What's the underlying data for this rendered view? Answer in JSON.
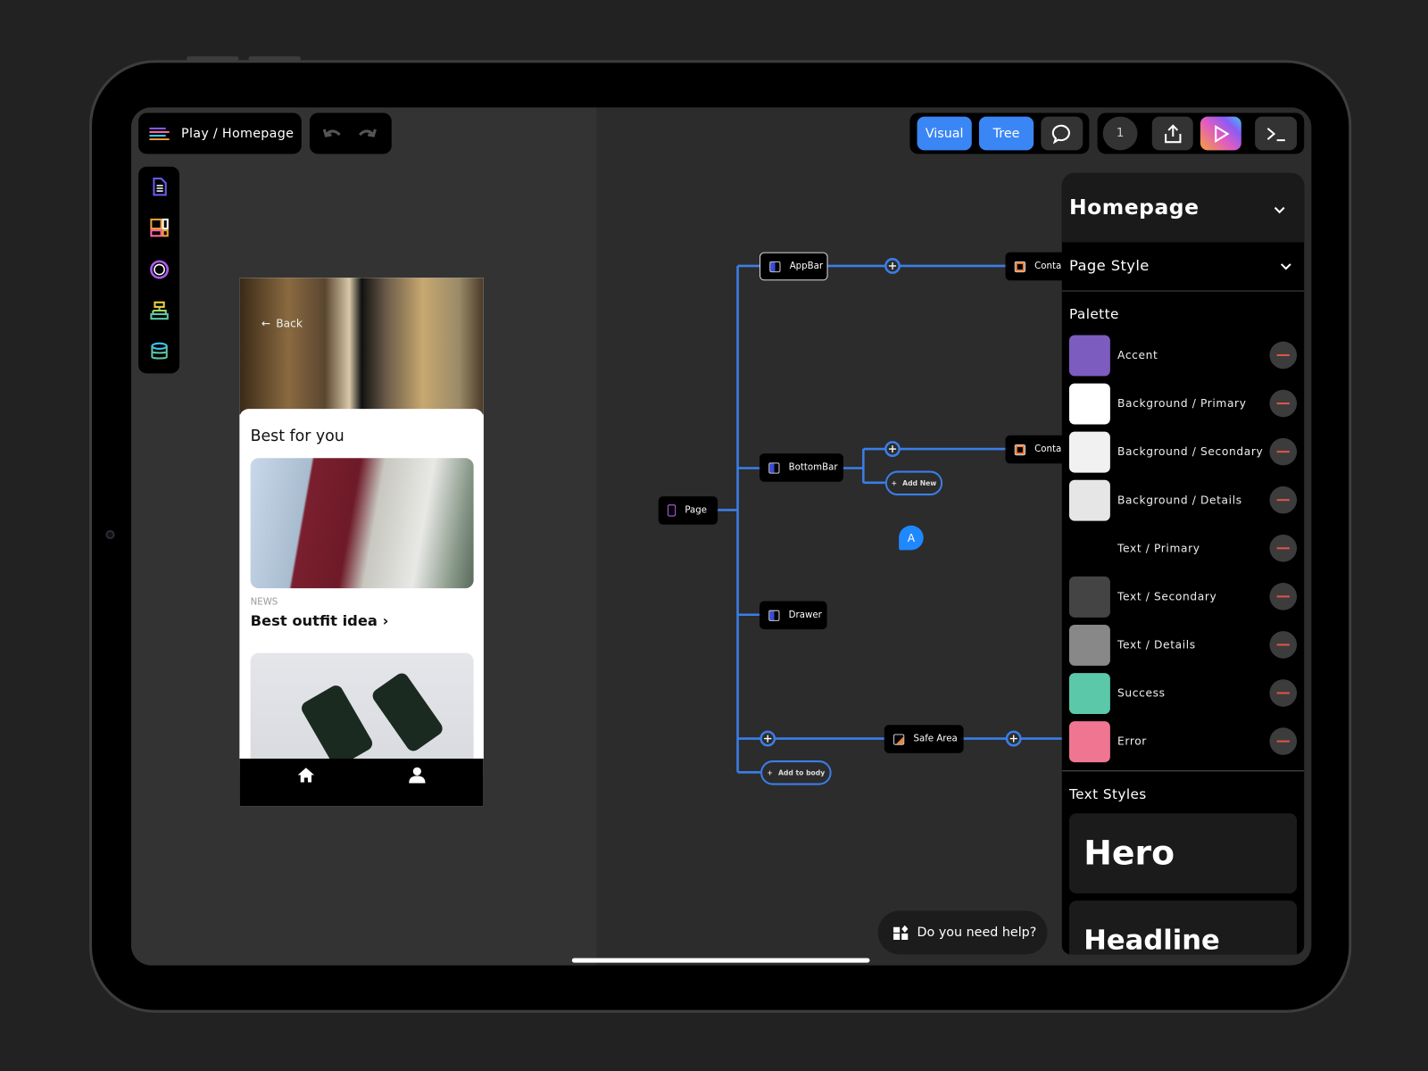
{
  "toolbar": {
    "breadcrumb": "Play / Homepage",
    "undo": "undo-icon",
    "redo": "redo-icon",
    "visual_label": "Visual",
    "tree_label": "Tree",
    "user_count": "1"
  },
  "sidebar": {
    "items": [
      {
        "icon": "pages-icon"
      },
      {
        "icon": "widgets-icon"
      },
      {
        "icon": "theme-icon"
      },
      {
        "icon": "tree-icon"
      },
      {
        "icon": "database-icon"
      }
    ]
  },
  "preview": {
    "back": "Back",
    "section_title": "Best for you",
    "news_label": "NEWS",
    "article_title": "Best outfit idea ›"
  },
  "tree": {
    "nodes": {
      "page": "Page",
      "appbar": "AppBar",
      "bottombar": "BottomBar",
      "drawer": "Drawer",
      "safearea": "Safe Area",
      "container1": "Conta",
      "container2": "Conta"
    },
    "add_new": "Add New",
    "add_to_body": "Add to body",
    "avatar": "A"
  },
  "panel": {
    "title": "Homepage",
    "page_style": "Page Style",
    "palette_title": "Palette",
    "palette": [
      {
        "name": "Accent",
        "color": "#7c5cbf"
      },
      {
        "name": "Background / Primary",
        "color": "#ffffff"
      },
      {
        "name": "Background / Secondary",
        "color": "#f1f1f1"
      },
      {
        "name": "Background / Details",
        "color": "#e6e6e6"
      },
      {
        "name": "Text / Primary",
        "color": "#000000"
      },
      {
        "name": "Text / Secondary",
        "color": "#444444"
      },
      {
        "name": "Text / Details",
        "color": "#888888"
      },
      {
        "name": "Success",
        "color": "#5bc8aa"
      },
      {
        "name": "Error",
        "color": "#ef7590"
      }
    ],
    "text_styles_title": "Text Styles",
    "text_styles": [
      "Hero",
      "Headline"
    ]
  },
  "help": {
    "label": "Do you need help?"
  },
  "colors": {
    "accent_blue": "#3b86f5",
    "tree_line": "#3a7ee8",
    "avatar": "#1e88ff"
  }
}
